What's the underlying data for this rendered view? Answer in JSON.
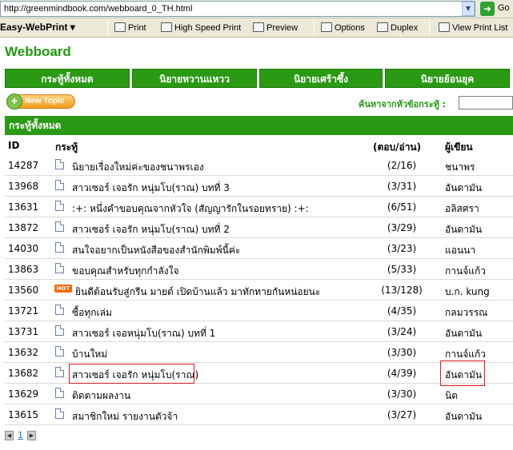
{
  "browser": {
    "url": "http://greenmindbook.com/webboard_0_TH.html",
    "go_label": "Go"
  },
  "toolbar": {
    "brand": "Easy-WebPrint",
    "print": "Print",
    "high_speed_print": "High Speed Print",
    "preview": "Preview",
    "options": "Options",
    "duplex": "Duplex",
    "view_print_list": "View Print List"
  },
  "page": {
    "title": "Webboard",
    "nav": [
      "กระทู้ทั้งหมด",
      "นิยายหวานแหวว",
      "นิยายเศร้าซึ้ง",
      "นิยายย้อนยุค"
    ],
    "new_topic": "New Topic",
    "search_label": "ค้นหาจากหัวข้อกระทู้ :",
    "section_title": "กระทู้ทั้งหมด"
  },
  "table": {
    "headers": {
      "id": "ID",
      "topic": "กระทู้",
      "count": "(ตอบ/อ่าน)",
      "author": "ผู้เขียน"
    },
    "rows": [
      {
        "id": "14287",
        "title": "นิยายเรื่องใหม่ค่ะของชนาพรเอง",
        "count": "(2/16)",
        "author": "ชนาพร",
        "hot": false
      },
      {
        "id": "13968",
        "title": "สาวเซอร์ เจอรัก หนุ่มโบ(ราณ) บทที่ 3",
        "count": "(3/31)",
        "author": "อันดามัน",
        "hot": false
      },
      {
        "id": "13631",
        "title": ":+: หนึ่งคำขอบคุณจากหัวใจ (สัญญารักในรอยทราย) :+:",
        "count": "(6/51)",
        "author": "อลิสศรา",
        "hot": false
      },
      {
        "id": "13872",
        "title": "สาวเซอร์ เจอรัก หนุ่มโบ(ราณ) บทที่ 2",
        "count": "(3/29)",
        "author": "อันดามัน",
        "hot": false
      },
      {
        "id": "14030",
        "title": "สนใจอยากเป็นหนังสือของสำนักพิมพ์นี้ค่ะ",
        "count": "(3/23)",
        "author": "แอนนา",
        "hot": false
      },
      {
        "id": "13863",
        "title": "ขอบคุณสำหรับทุกกำลังใจ",
        "count": "(5/33)",
        "author": "กานจ์แก้ว",
        "hot": false
      },
      {
        "id": "13560",
        "title": "ยินดีต้อนรับสู่กรีน มายด์ เปิดบ้านแล้ว มาทักทายกันหน่อยนะ",
        "count": "(13/128)",
        "author": "บ.ก. kung",
        "hot": true,
        "hot_label": "HOT"
      },
      {
        "id": "13721",
        "title": "ซื้อทุกเล่ม",
        "count": "(4/35)",
        "author": "กลมวรรณ",
        "hot": false
      },
      {
        "id": "13731",
        "title": "สาวเซอร์ เจอหนุ่มโบ(ราณ) บทที่ 1",
        "count": "(3/24)",
        "author": "อันดามัน",
        "hot": false
      },
      {
        "id": "13632",
        "title": "บ้านใหม่",
        "count": "(3/30)",
        "author": "กานจ์แก้ว",
        "hot": false
      },
      {
        "id": "13682",
        "title": "สาวเซอร์ เจอรัก หนุ่มโบ(ราณ)",
        "count": "(4/39)",
        "author": "อันดามัน",
        "hot": false
      },
      {
        "id": "13629",
        "title": "ติดตามผลงาน",
        "count": "(3/30)",
        "author": "นิด",
        "hot": false
      },
      {
        "id": "13615",
        "title": "สมาชิกใหม่ รายงานตัวจ้า",
        "count": "(3/27)",
        "author": "อันดามัน",
        "hot": false
      }
    ]
  },
  "pager": {
    "current": "1"
  },
  "colors": {
    "accent": "#2a9a14",
    "highlight": "#e0161c"
  }
}
